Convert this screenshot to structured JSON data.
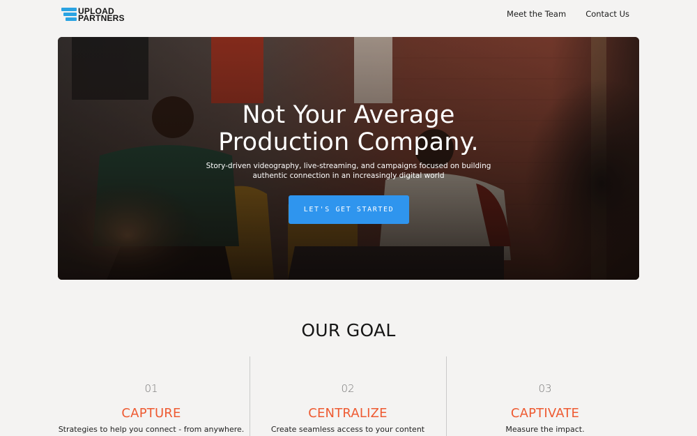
{
  "header": {
    "logo_line1": "UPLOAD",
    "logo_line2": "PARTNERS",
    "nav": [
      {
        "label": "Meet the Team"
      },
      {
        "label": "Contact Us"
      }
    ]
  },
  "hero": {
    "title_line1": "Not Your Average",
    "title_line2": "Production Company.",
    "subtitle_line1": "Story-driven videography, live-streaming, and campaigns focused on building",
    "subtitle_line2": "authentic connection in an increasingly digital world",
    "cta_label": "LET'S GET STARTED"
  },
  "goal": {
    "title": "OUR GOAL",
    "items": [
      {
        "number": "01",
        "heading": "CAPTURE",
        "text": "Strategies to help you connect - from anywhere."
      },
      {
        "number": "02",
        "heading": "CENTRALIZE",
        "text": "Create seamless access to your content"
      },
      {
        "number": "03",
        "heading": "CAPTIVATE",
        "text": "Measure the impact."
      }
    ]
  },
  "colors": {
    "accent_blue": "#2f95ee",
    "logo_blue": "#2aa3e2",
    "heading_orange": "#ee5a31",
    "page_bg": "#f4f3f2"
  }
}
